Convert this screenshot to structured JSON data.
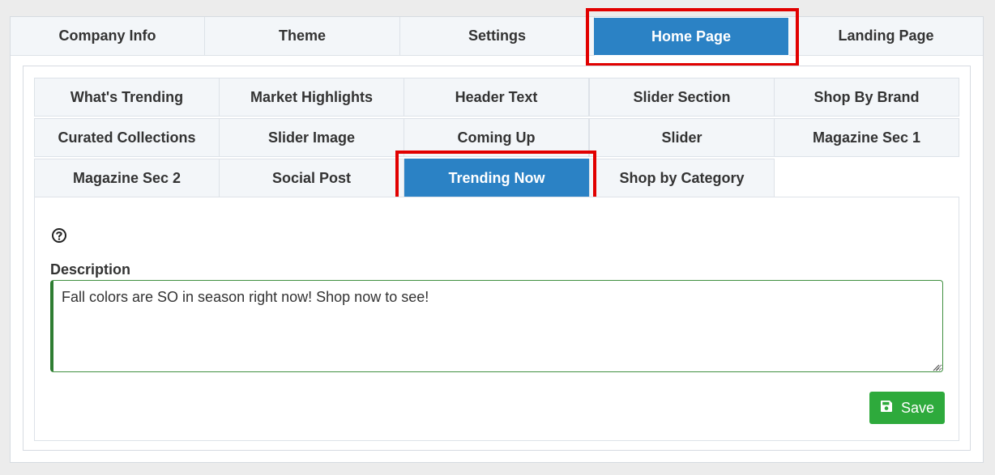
{
  "top_tabs": [
    {
      "label": "Company Info"
    },
    {
      "label": "Theme"
    },
    {
      "label": "Settings"
    },
    {
      "label": "Home Page",
      "active": true
    },
    {
      "label": "Landing Page"
    }
  ],
  "sub_tabs": [
    {
      "label": "What's Trending"
    },
    {
      "label": "Market Highlights"
    },
    {
      "label": "Header Text"
    },
    {
      "label": "Slider Section"
    },
    {
      "label": "Shop By Brand"
    },
    {
      "label": "Curated Collections"
    },
    {
      "label": "Slider Image"
    },
    {
      "label": "Coming Up"
    },
    {
      "label": "Slider"
    },
    {
      "label": "Magazine Sec 1"
    },
    {
      "label": "Magazine Sec 2"
    },
    {
      "label": "Social Post"
    },
    {
      "label": "Trending Now",
      "active": true
    },
    {
      "label": "Shop by Category"
    }
  ],
  "form": {
    "help_icon": "question-circle-icon",
    "description_label": "Description",
    "description_value": "Fall colors are SO in season right now! Shop now to see!"
  },
  "actions": {
    "save_label": "Save",
    "save_icon": "floppy-disk-icon"
  },
  "colors": {
    "active_tab": "#2b82c5",
    "highlight": "#e10000",
    "save_button": "#2eaa3c",
    "field_border": "#2e7d32"
  }
}
